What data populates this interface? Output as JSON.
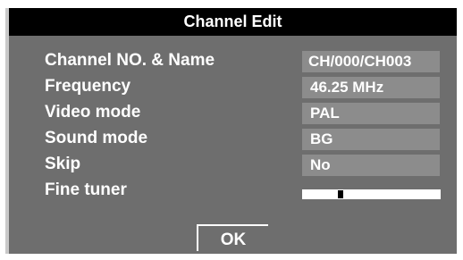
{
  "title": "Channel Edit",
  "rows": [
    {
      "label": "Channel NO. & Name",
      "value": "CH/000/CH003"
    },
    {
      "label": "Frequency",
      "value": "46.25 MHz"
    },
    {
      "label": "Video mode",
      "value": "PAL"
    },
    {
      "label": "Sound mode",
      "value": "BG"
    },
    {
      "label": "Skip",
      "value": "No"
    }
  ],
  "fine_tuner": {
    "label": "Fine tuner",
    "level": 0.27
  },
  "ok_label": "OK",
  "colors": {
    "panel": "#6e6e6e",
    "title_bar": "#000000",
    "value_box": "#8c8c8c",
    "text": "#ffffff"
  }
}
